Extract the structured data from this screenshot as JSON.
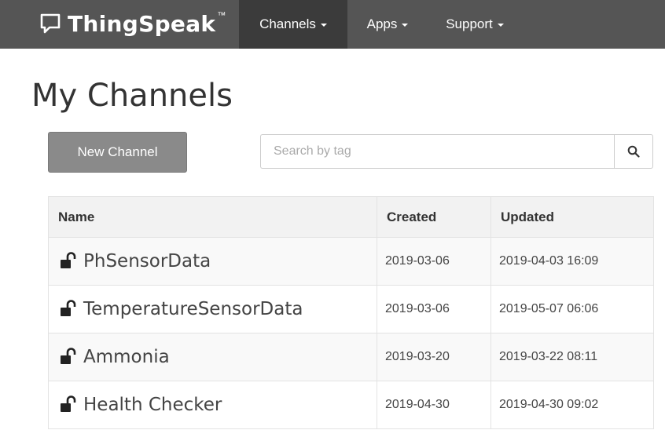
{
  "navbar": {
    "brand": "ThingSpeak",
    "trademark": "™",
    "items": [
      {
        "label": "Channels",
        "active": true
      },
      {
        "label": "Apps",
        "active": false
      },
      {
        "label": "Support",
        "active": false
      }
    ]
  },
  "page": {
    "title": "My Channels"
  },
  "actions": {
    "new_channel_label": "New Channel"
  },
  "search": {
    "placeholder": "Search by tag",
    "value": ""
  },
  "table": {
    "headers": {
      "name": "Name",
      "created": "Created",
      "updated": "Updated"
    },
    "rows": [
      {
        "name": "PhSensorData",
        "created": "2019-03-06",
        "updated": "2019-04-03 16:09",
        "icon": "unlock-icon"
      },
      {
        "name": "TemperatureSensorData",
        "created": "2019-03-06",
        "updated": "2019-05-07 06:06",
        "icon": "unlock-icon"
      },
      {
        "name": "Ammonia",
        "created": "2019-03-20",
        "updated": "2019-03-22 08:11",
        "icon": "unlock-icon"
      },
      {
        "name": "Health Checker",
        "created": "2019-04-30",
        "updated": "2019-04-30 09:02",
        "icon": "unlock-icon"
      }
    ]
  },
  "colors": {
    "navbar": "#555555",
    "navbar_active": "#3b3b3b",
    "button": "#8a8a8a",
    "table_header": "#f2f2f2"
  }
}
